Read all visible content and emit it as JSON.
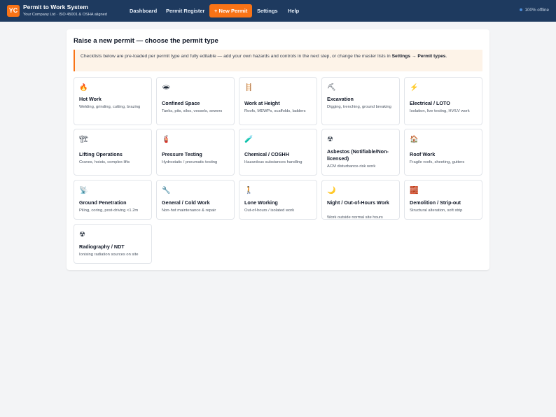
{
  "app": {
    "logo_text": "YC",
    "title": "Permit to Work System",
    "subtitle": "Your Company Ltd · ISO 45001 & OSHA aligned"
  },
  "nav": {
    "dashboard": "Dashboard",
    "register": "Permit Register",
    "new_permit": "+ New Permit",
    "settings": "Settings",
    "help": "Help"
  },
  "status": {
    "offline": "100% offline"
  },
  "page": {
    "title": "Raise a new permit — choose the permit type",
    "notice_text": "Checklists below are pre-loaded per permit type and fully editable — add your own hazards and controls in the next step, or change the master lists in ",
    "notice_link": "Settings → Permit types",
    "notice_end": "."
  },
  "permit_types": [
    {
      "icon": "🔥",
      "name": "Hot Work",
      "desc": "Welding, grinding, cutting, brazing"
    },
    {
      "icon": "🕳",
      "name": "Confined Space",
      "desc": "Tanks, pits, silos, vessels, sewers"
    },
    {
      "icon": "🪜",
      "name": "Work at Height",
      "desc": "Roofs, MEWPs, scaffolds, ladders"
    },
    {
      "icon": "⛏",
      "name": "Excavation",
      "desc": "Digging, trenching, ground breaking"
    },
    {
      "icon": "⚡",
      "name": "Electrical / LOTO",
      "desc": "Isolation, live testing, HV/LV work"
    },
    {
      "icon": "🏗",
      "name": "Lifting Operations",
      "desc": "Cranes, hoists, complex lifts"
    },
    {
      "icon": "🧯",
      "name": "Pressure Testing",
      "desc": "Hydrostatic / pneumatic testing"
    },
    {
      "icon": "🧪",
      "name": "Chemical / COSHH",
      "desc": "Hazardous substances handling"
    },
    {
      "icon": "☢",
      "name": "Asbestos (Notifiable/Non-licensed)",
      "desc": "ACM disturbance-risk work"
    },
    {
      "icon": "🏠",
      "name": "Roof Work",
      "desc": "Fragile roofs, sheeting, gutters"
    },
    {
      "icon": "📡",
      "name": "Ground Penetration",
      "desc": "Piling, coring, post-driving <1.2m"
    },
    {
      "icon": "🔧",
      "name": "General / Cold Work",
      "desc": "Non-hot maintenance & repair"
    },
    {
      "icon": "🚶",
      "name": "Lone Working",
      "desc": "Out-of-hours / isolated work"
    },
    {
      "icon": "🌙",
      "name": "Night / Out-of-Hours Work",
      "desc": "Work outside normal site hours"
    },
    {
      "icon": "🧱",
      "name": "Demolition / Strip-out",
      "desc": "Structural alteration, soft strip"
    },
    {
      "icon": "☢",
      "name": "Radiography / NDT",
      "desc": "Ionising radiation sources on site"
    }
  ]
}
